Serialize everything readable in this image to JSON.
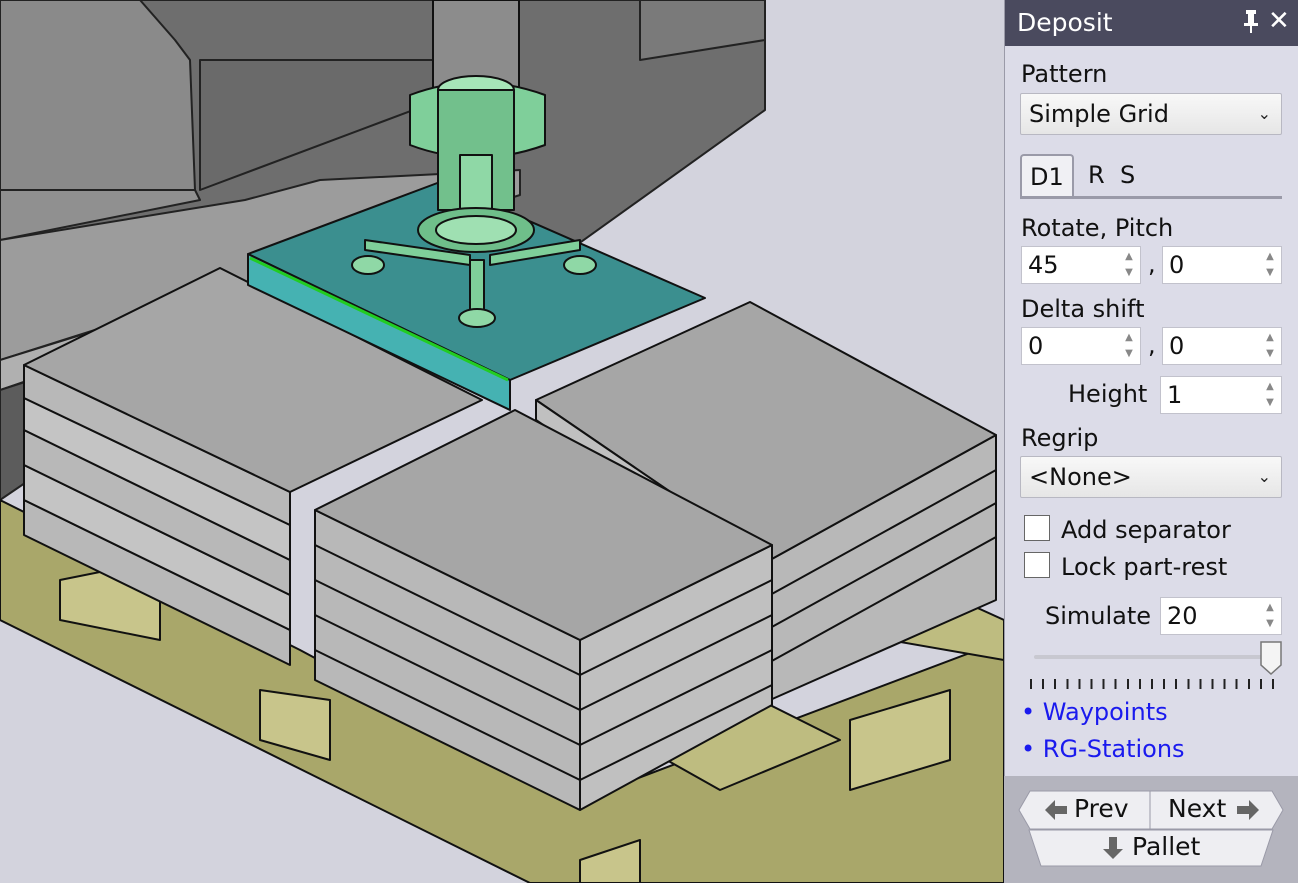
{
  "panel": {
    "title": "Deposit",
    "pattern_label": "Pattern",
    "pattern_value": "Simple Grid",
    "tabs": [
      "D1",
      "R",
      "S"
    ],
    "rotate_pitch_label": "Rotate, Pitch",
    "rotate_value": "45",
    "pitch_value": "0",
    "delta_shift_label": "Delta shift",
    "delta_x": "0",
    "delta_y": "0",
    "separator_comma": ",",
    "height_label": "Height",
    "height_value": "1",
    "regrip_label": "Regrip",
    "regrip_value": "<None>",
    "add_separator_label": "Add separator",
    "lock_part_rest_label": "Lock part-rest",
    "simulate_label": "Simulate",
    "simulate_value": "20",
    "simulate_slider_fraction": 1.0,
    "links": [
      "• Waypoints",
      "• RG-Stations"
    ],
    "prev_label": "Prev",
    "next_label": "Next",
    "pallet_label": "Pallet"
  },
  "colors": {
    "title_bar": "#4a4a5e",
    "link": "#1a1aee",
    "gripper": "#7fcf9a",
    "plate": "#3b8f8f",
    "pallet": "#a9a76a",
    "part": "#a6a6a6"
  },
  "icons": {
    "pin": "pin-icon",
    "close": "close-icon",
    "prev": "arrow-left-icon",
    "next": "arrow-right-icon",
    "pallet": "arrow-down-icon"
  }
}
